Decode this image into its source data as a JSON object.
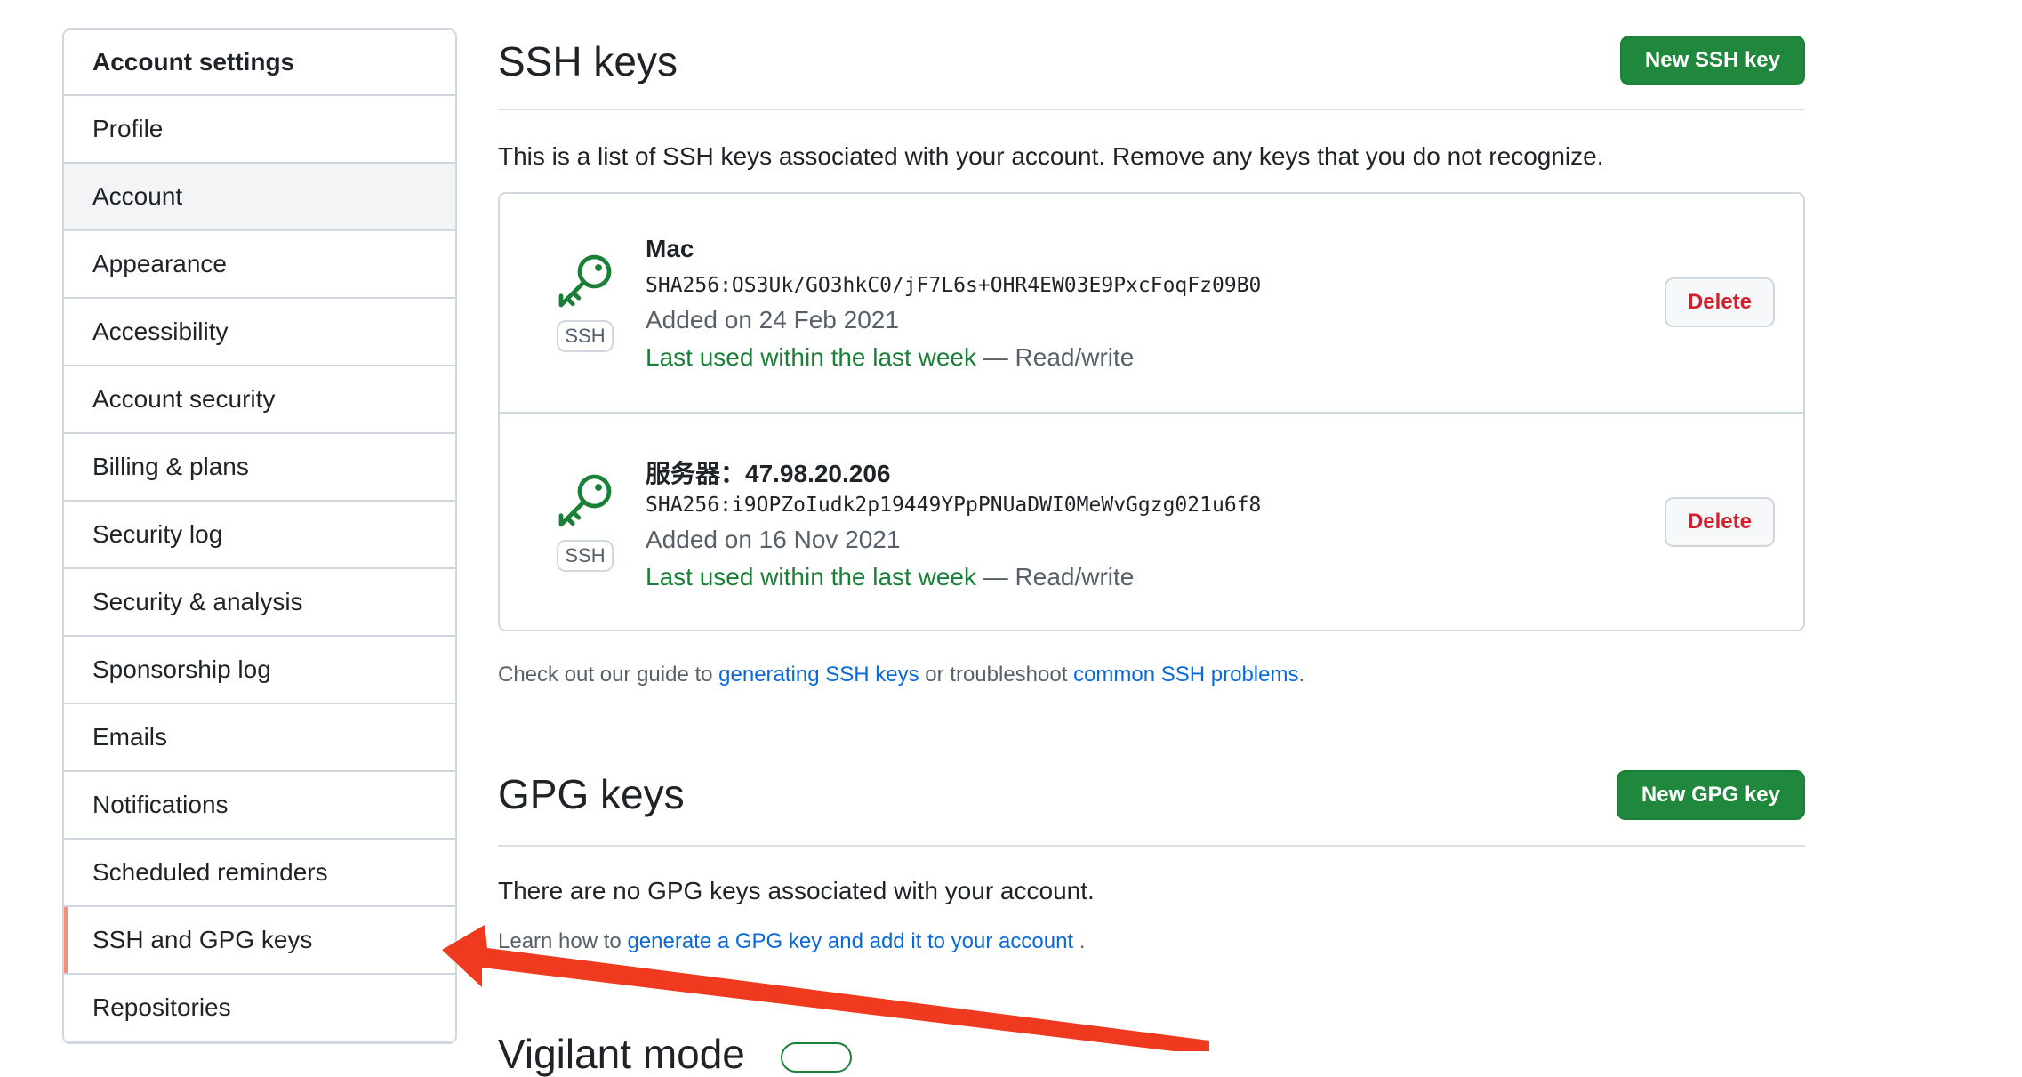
{
  "sidebar": {
    "header": "Account settings",
    "items": [
      {
        "label": "Profile"
      },
      {
        "label": "Account"
      },
      {
        "label": "Appearance"
      },
      {
        "label": "Accessibility"
      },
      {
        "label": "Account security"
      },
      {
        "label": "Billing & plans"
      },
      {
        "label": "Security log"
      },
      {
        "label": "Security & analysis"
      },
      {
        "label": "Sponsorship log"
      },
      {
        "label": "Emails"
      },
      {
        "label": "Notifications"
      },
      {
        "label": "Scheduled reminders"
      },
      {
        "label": "SSH and GPG keys"
      },
      {
        "label": "Repositories"
      }
    ]
  },
  "ssh": {
    "title": "SSH keys",
    "new_button": "New SSH key",
    "intro": "This is a list of SSH keys associated with your account. Remove any keys that you do not recognize.",
    "badge": "SSH",
    "keys": [
      {
        "name": "Mac",
        "fingerprint": "SHA256:OS3Uk/GO3hkC0/jF7L6s+OHR4EW03E9PxcFoqFz09B0",
        "added": "Added on 24 Feb 2021",
        "last_used": "Last used within the last week",
        "access": " — Read/write",
        "delete_label": "Delete"
      },
      {
        "name": "服务器：47.98.20.206",
        "fingerprint": "SHA256:i9OPZoIudk2p19449YPpPNUaDWI0MeWvGgzg021u6f8",
        "added": "Added on 16 Nov 2021",
        "last_used": "Last used within the last week",
        "access": " — Read/write",
        "delete_label": "Delete"
      }
    ],
    "guide": {
      "prefix": "Check out our guide to ",
      "link1": "generating SSH keys",
      "middle": " or troubleshoot ",
      "link2": "common SSH problems",
      "suffix": "."
    }
  },
  "gpg": {
    "title": "GPG keys",
    "new_button": "New GPG key",
    "empty": "There are no GPG keys associated with your account.",
    "learn": {
      "prefix": "Learn how to ",
      "link": "generate a GPG key and add it to your account",
      "suffix": " ."
    }
  },
  "next_section": {
    "title": "Vigilant mode"
  },
  "colors": {
    "accent_green": "#1f883d",
    "link_blue": "#0969da",
    "danger_red": "#cf222e",
    "selected_marker": "#fd8c73",
    "arrow_red": "#f03a1f"
  }
}
